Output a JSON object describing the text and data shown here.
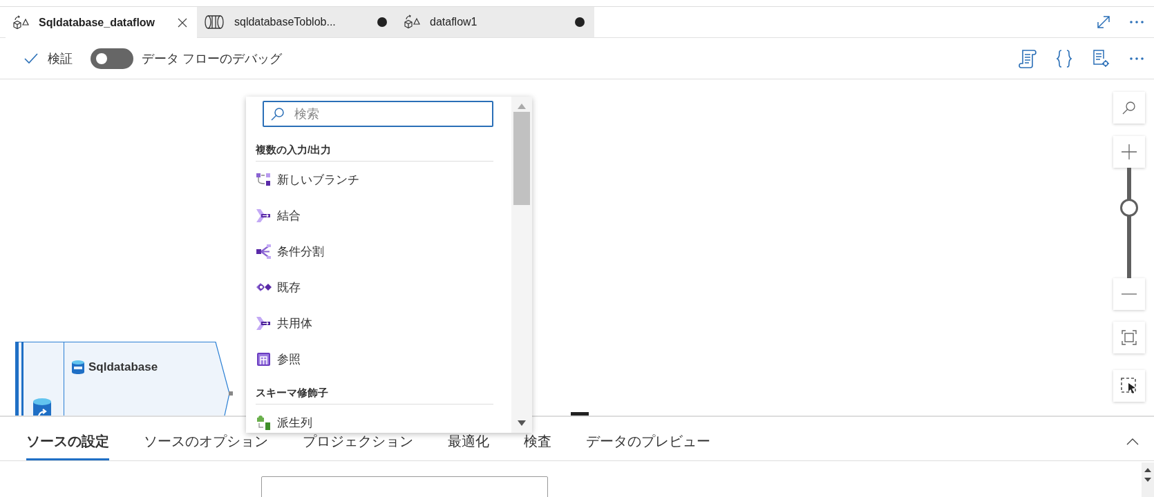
{
  "document_tabs": [
    {
      "label": "Sqldatabase_dataflow",
      "kind": "dataflow",
      "selected": true,
      "unsaved": false
    },
    {
      "label": "sqldatabaseToblob...",
      "kind": "pipeline",
      "selected": false,
      "unsaved": true
    },
    {
      "label": "dataflow1",
      "kind": "dataflow",
      "selected": false,
      "unsaved": true
    }
  ],
  "toolbar": {
    "validate": "検証",
    "debug": {
      "label": "データ フローのデバッグ",
      "on": false
    }
  },
  "canvas": {
    "node": {
      "title": "Sqldatabase"
    },
    "menu": {
      "search_placeholder": "検索",
      "sections": [
        {
          "heading": "複数の入力/出力",
          "items": [
            {
              "label": "新しいブランチ",
              "kind": "branch"
            },
            {
              "label": "結合",
              "kind": "join"
            },
            {
              "label": "条件分割",
              "kind": "split"
            },
            {
              "label": "既存",
              "kind": "exists"
            },
            {
              "label": "共用体",
              "kind": "union"
            },
            {
              "label": "参照",
              "kind": "lookup"
            }
          ]
        },
        {
          "heading": "スキーマ修飾子",
          "items": [
            {
              "label": "派生列",
              "kind": "derived"
            }
          ]
        }
      ]
    },
    "zoom": {
      "level": 0.64
    }
  },
  "panel": {
    "tabs": [
      {
        "label": "ソースの設定",
        "selected": true
      },
      {
        "label": "ソースのオプション",
        "selected": false
      },
      {
        "label": "プロジェクション",
        "selected": false
      },
      {
        "label": "最適化",
        "selected": false
      },
      {
        "label": "検査",
        "selected": false
      },
      {
        "label": "データのプレビュー",
        "selected": false
      }
    ]
  }
}
